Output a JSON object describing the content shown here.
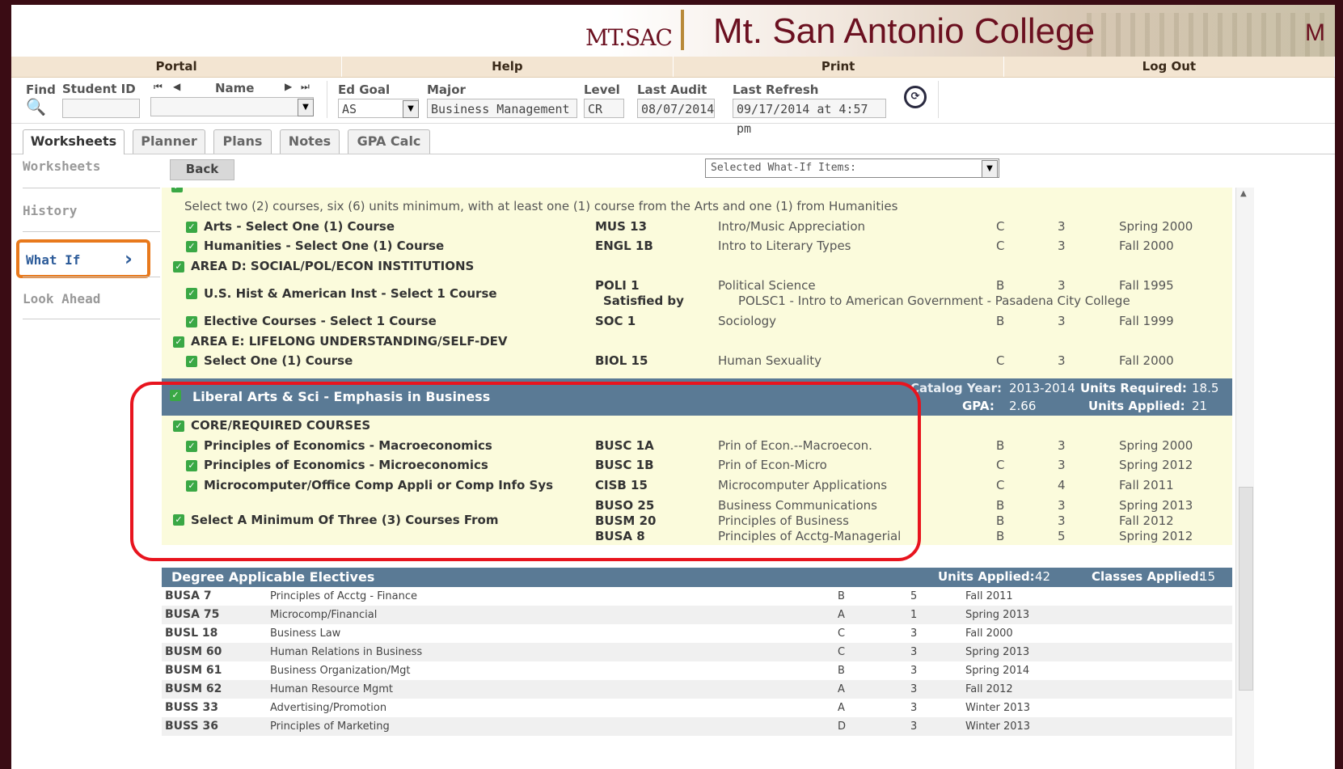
{
  "header": {
    "logo_text": "MT.SAC",
    "college_name": "Mt. San Antonio College",
    "college_name_tail": "M"
  },
  "menu": [
    "Portal",
    "Help",
    "Print",
    "Log Out"
  ],
  "toolbar": {
    "find": "Find",
    "student_id": "Student ID",
    "name": "Name",
    "ed_goal_label": "Ed Goal",
    "ed_goal_value": "AS",
    "major_label": "Major",
    "major_value": "Business Management",
    "level_label": "Level",
    "level_value": "CR",
    "last_audit_label": "Last Audit",
    "last_audit_value": "08/07/2014",
    "last_refresh_label": "Last Refresh",
    "last_refresh_value": "09/17/2014 at 4:57 pm"
  },
  "tabs": [
    "Worksheets",
    "Planner",
    "Plans",
    "Notes",
    "GPA Calc"
  ],
  "sidebar": [
    "Worksheets",
    "History",
    "What If",
    "Look Ahead"
  ],
  "back_label": "Back",
  "whatif_select": "Selected What-If Items:",
  "area_c": {
    "instructions": "Select two (2) courses, six (6) units minimum, with at least one (1)  course from the Arts and one (1) from Humanities",
    "rows": [
      {
        "req": "Arts - Select One (1) Course",
        "course": "MUS 13",
        "title": "Intro/Music Appreciation",
        "grade": "C",
        "units": "3",
        "term": "Spring 2000"
      },
      {
        "req": "Humanities - Select One (1) Course",
        "course": "ENGL 1B",
        "title": "Intro to Literary Types",
        "grade": "C",
        "units": "3",
        "term": "Fall 2000"
      }
    ]
  },
  "area_d": {
    "title": "AREA D: SOCIAL/POL/ECON INSTITUTIONS",
    "rows": [
      {
        "req": "U.S. Hist & American Inst - Select 1 Course",
        "course": "POLI 1",
        "title": "Political Science",
        "grade": "B",
        "units": "3",
        "term": "Fall 1995",
        "satisfied_label": "Satisfied by",
        "satisfied_text": "POLSC1 - Intro to American Government - Pasadena City College"
      },
      {
        "req": "Elective Courses - Select 1 Course",
        "course": "SOC 1",
        "title": "Sociology",
        "grade": "B",
        "units": "3",
        "term": "Fall 1999"
      }
    ]
  },
  "area_e": {
    "title": "AREA E: LIFELONG UNDERSTANDING/SELF-DEV",
    "rows": [
      {
        "req": "Select One (1) Course",
        "course": "BIOL 15",
        "title": "Human Sexuality",
        "grade": "C",
        "units": "3",
        "term": "Fall 2000"
      }
    ]
  },
  "program": {
    "title": "Liberal Arts & Sci - Emphasis in Business",
    "catalog_year_label": "Catalog Year:",
    "catalog_year": "2013-2014",
    "units_required_label": "Units Required:",
    "units_required": "18.5",
    "gpa_label": "GPA:",
    "gpa": "2.66",
    "units_applied_label": "Units Applied:",
    "units_applied": "21",
    "core_title": "CORE/REQUIRED COURSES",
    "core_rows": [
      {
        "req": "Principles of Economics - Macroeconomics",
        "course": "BUSC 1A",
        "title": "Prin of Econ.--Macroecon.",
        "grade": "B",
        "units": "3",
        "term": "Spring 2000"
      },
      {
        "req": "Principles of Economics - Microeconomics",
        "course": "BUSC 1B",
        "title": "Prin of Econ-Micro",
        "grade": "C",
        "units": "3",
        "term": "Spring 2012"
      },
      {
        "req": "Microcomputer/Office Comp Appli or Comp Info Sys",
        "course": "CISB 15",
        "title": "Microcomputer Applications",
        "grade": "C",
        "units": "4",
        "term": "Fall 2011"
      }
    ],
    "select_three": "Select A Minimum Of Three (3) Courses From",
    "select_rows": [
      {
        "course": "BUSO 25",
        "title": "Business Communications",
        "grade": "B",
        "units": "3",
        "term": "Spring 2013"
      },
      {
        "course": "BUSM 20",
        "title": "Principles of Business",
        "grade": "B",
        "units": "3",
        "term": "Fall 2012"
      },
      {
        "course": "BUSA 8",
        "title": "Principles of Acctg-Managerial",
        "grade": "B",
        "units": "5",
        "term": "Spring 2012"
      }
    ]
  },
  "electives": {
    "title": "Degree Applicable Electives",
    "units_applied_label": "Units Applied:",
    "units_applied": "42",
    "classes_applied_label": "Classes Applied:",
    "classes_applied": "15",
    "rows": [
      {
        "course": "BUSA 7",
        "title": "Principles of Acctg - Finance",
        "grade": "B",
        "units": "5",
        "term": "Fall 2011"
      },
      {
        "course": "BUSA 75",
        "title": "Microcomp/Financial",
        "grade": "A",
        "units": "1",
        "term": "Spring 2013"
      },
      {
        "course": "BUSL 18",
        "title": "Business Law",
        "grade": "C",
        "units": "3",
        "term": "Fall 2000"
      },
      {
        "course": "BUSM 60",
        "title": "Human Relations in Business",
        "grade": "C",
        "units": "3",
        "term": "Spring 2013"
      },
      {
        "course": "BUSM 61",
        "title": "Business Organization/Mgt",
        "grade": "B",
        "units": "3",
        "term": "Spring 2014"
      },
      {
        "course": "BUSM 62",
        "title": "Human Resource Mgmt",
        "grade": "A",
        "units": "3",
        "term": "Fall 2012"
      },
      {
        "course": "BUSS 33",
        "title": "Advertising/Promotion",
        "grade": "A",
        "units": "3",
        "term": "Winter 2013"
      },
      {
        "course": "BUSS 36",
        "title": "Principles of Marketing",
        "grade": "D",
        "units": "3",
        "term": "Winter 2013"
      }
    ]
  }
}
